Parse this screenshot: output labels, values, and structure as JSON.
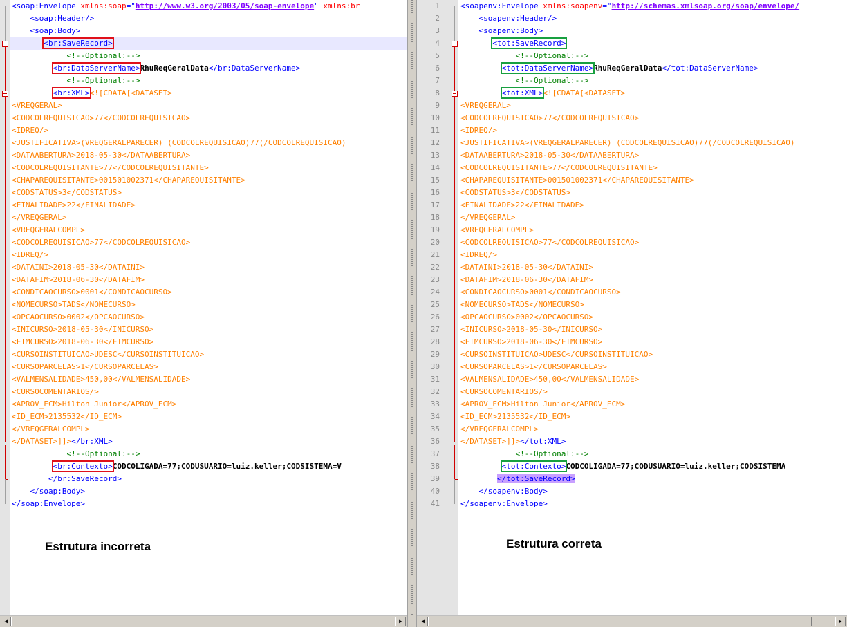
{
  "left": {
    "caption": "Estrutura incorreta",
    "lines": [
      [
        [
          "t",
          "<soap:Envelope "
        ],
        [
          "a",
          "xmlns:soap"
        ],
        [
          "t",
          "=\""
        ],
        [
          "v",
          "http://www.w3.org/2003/05/soap-envelope"
        ],
        [
          "t",
          "\" "
        ],
        [
          "a",
          "xmlns:br"
        ]
      ],
      [
        [
          "t",
          "    <soap:Header/>"
        ]
      ],
      [
        [
          "t",
          "    <soap:Body>"
        ]
      ],
      [
        [
          "s",
          "       "
        ],
        [
          "tbr",
          "<br:SaveRecord>"
        ]
      ],
      [
        [
          "s",
          "            "
        ],
        [
          "c",
          "<!--Optional:-->"
        ]
      ],
      [
        [
          "s",
          "         "
        ],
        [
          "tbr",
          "<br:DataServerName>"
        ],
        [
          "x",
          "RhuReqGeralData"
        ],
        [
          "t",
          "</br:DataServerName>"
        ]
      ],
      [
        [
          "s",
          "            "
        ],
        [
          "c",
          "<!--Optional:-->"
        ]
      ],
      [
        [
          "s",
          "         "
        ],
        [
          "tbr",
          "<br:XML>"
        ],
        [
          "d",
          "<![CDATA[<DATASET>"
        ]
      ],
      [
        [
          "d",
          "<VREQGERAL>"
        ]
      ],
      [
        [
          "d",
          "<CODCOLREQUISICAO>77</CODCOLREQUISICAO>"
        ]
      ],
      [
        [
          "d",
          "<IDREQ/>"
        ]
      ],
      [
        [
          "d",
          "<JUSTIFICATIVA>(VREQGERALPARECER) (CODCOLREQUISICAO)77(/CODCOLREQUISICAO)"
        ]
      ],
      [
        [
          "d",
          "<DATAABERTURA>2018-05-30</DATAABERTURA>"
        ]
      ],
      [
        [
          "d",
          "<CODCOLREQUISITANTE>77</CODCOLREQUISITANTE>"
        ]
      ],
      [
        [
          "d",
          "<CHAPAREQUISITANTE>001501002371</CHAPAREQUISITANTE>"
        ]
      ],
      [
        [
          "d",
          "<CODSTATUS>3</CODSTATUS>"
        ]
      ],
      [
        [
          "d",
          "<FINALIDADE>22</FINALIDADE>"
        ]
      ],
      [
        [
          "d",
          "</VREQGERAL>"
        ]
      ],
      [
        [
          "d",
          "<VREQGERALCOMPL>"
        ]
      ],
      [
        [
          "d",
          "<CODCOLREQUISICAO>77</CODCOLREQUISICAO>"
        ]
      ],
      [
        [
          "d",
          "<IDREQ/>"
        ]
      ],
      [
        [
          "d",
          "<DATAINI>2018-05-30</DATAINI>"
        ]
      ],
      [
        [
          "d",
          "<DATAFIM>2018-06-30</DATAFIM>"
        ]
      ],
      [
        [
          "d",
          "<CONDICAOCURSO>0001</CONDICAOCURSO>"
        ]
      ],
      [
        [
          "d",
          "<NOMECURSO>TADS</NOMECURSO>"
        ]
      ],
      [
        [
          "d",
          "<OPCAOCURSO>0002</OPCAOCURSO>"
        ]
      ],
      [
        [
          "d",
          "<INICURSO>2018-05-30</INICURSO>"
        ]
      ],
      [
        [
          "d",
          "<FIMCURSO>2018-06-30</FIMCURSO>"
        ]
      ],
      [
        [
          "d",
          "<CURSOINSTITUICAO>UDESC</CURSOINSTITUICAO>"
        ]
      ],
      [
        [
          "d",
          "<CURSOPARCELAS>1</CURSOPARCELAS>"
        ]
      ],
      [
        [
          "d",
          "<VALMENSALIDADE>450,00</VALMENSALIDADE>"
        ]
      ],
      [
        [
          "d",
          "<CURSOCOMENTARIOS/>"
        ]
      ],
      [
        [
          "d",
          "<APROV_ECM>Hilton Junior</APROV_ECM>"
        ]
      ],
      [
        [
          "d",
          "<ID_ECM>2135532</ID_ECM>"
        ]
      ],
      [
        [
          "d",
          "</VREQGERALCOMPL>"
        ]
      ],
      [
        [
          "d",
          "</DATASET>]]>"
        ],
        [
          "t",
          "</br:XML>"
        ]
      ],
      [
        [
          "s",
          "            "
        ],
        [
          "c",
          "<!--Optional:-->"
        ]
      ],
      [
        [
          "s",
          "         "
        ],
        [
          "tbr",
          "<br:Contexto>"
        ],
        [
          "x",
          "CODCOLIGADA=77;CODUSUARIO=luiz.keller;CODSISTEMA=V"
        ]
      ],
      [
        [
          "t",
          "        </br:SaveRecord>"
        ]
      ],
      [
        [
          "t",
          "    </soap:Body>"
        ]
      ],
      [
        [
          "t",
          "</soap:Envelope>"
        ]
      ]
    ]
  },
  "right": {
    "caption": "Estrutura correta",
    "line_numbers": [
      "1",
      "2",
      "3",
      "4",
      "5",
      "6",
      "7",
      "8",
      "9",
      "10",
      "11",
      "12",
      "13",
      "14",
      "15",
      "16",
      "17",
      "18",
      "19",
      "20",
      "21",
      "22",
      "23",
      "24",
      "25",
      "26",
      "27",
      "28",
      "29",
      "30",
      "31",
      "32",
      "33",
      "34",
      "35",
      "36",
      "37",
      "38",
      "39",
      "40",
      "41"
    ],
    "lines": [
      [
        [
          "t",
          "<soapenv:Envelope "
        ],
        [
          "a",
          "xmlns:soapenv"
        ],
        [
          "t",
          "=\""
        ],
        [
          "v",
          "http://schemas.xmlsoap.org/soap/envelope/"
        ]
      ],
      [
        [
          "t",
          "    <soapenv:Header/>"
        ]
      ],
      [
        [
          "t",
          "    <soapenv:Body>"
        ]
      ],
      [
        [
          "s",
          "       "
        ],
        [
          "tbg",
          "<tot:SaveRecord>"
        ]
      ],
      [
        [
          "s",
          "            "
        ],
        [
          "c",
          "<!--Optional:-->"
        ]
      ],
      [
        [
          "s",
          "         "
        ],
        [
          "tbg",
          "<tot:DataServerName>"
        ],
        [
          "x",
          "RhuReqGeralData"
        ],
        [
          "t",
          "</tot:DataServerName>"
        ]
      ],
      [
        [
          "s",
          "            "
        ],
        [
          "c",
          "<!--Optional:-->"
        ]
      ],
      [
        [
          "s",
          "         "
        ],
        [
          "tbg",
          "<tot:XML>"
        ],
        [
          "d",
          "<![CDATA[<DATASET>"
        ]
      ],
      [
        [
          "d",
          "<VREQGERAL>"
        ]
      ],
      [
        [
          "d",
          "<CODCOLREQUISICAO>77</CODCOLREQUISICAO>"
        ]
      ],
      [
        [
          "d",
          "<IDREQ/>"
        ]
      ],
      [
        [
          "d",
          "<JUSTIFICATIVA>(VREQGERALPARECER) (CODCOLREQUISICAO)77(/CODCOLREQUISICAO)"
        ]
      ],
      [
        [
          "d",
          "<DATAABERTURA>2018-05-30</DATAABERTURA>"
        ]
      ],
      [
        [
          "d",
          "<CODCOLREQUISITANTE>77</CODCOLREQUISITANTE>"
        ]
      ],
      [
        [
          "d",
          "<CHAPAREQUISITANTE>001501002371</CHAPAREQUISITANTE>"
        ]
      ],
      [
        [
          "d",
          "<CODSTATUS>3</CODSTATUS>"
        ]
      ],
      [
        [
          "d",
          "<FINALIDADE>22</FINALIDADE>"
        ]
      ],
      [
        [
          "d",
          "</VREQGERAL>"
        ]
      ],
      [
        [
          "d",
          "<VREQGERALCOMPL>"
        ]
      ],
      [
        [
          "d",
          "<CODCOLREQUISICAO>77</CODCOLREQUISICAO>"
        ]
      ],
      [
        [
          "d",
          "<IDREQ/>"
        ]
      ],
      [
        [
          "d",
          "<DATAINI>2018-05-30</DATAINI>"
        ]
      ],
      [
        [
          "d",
          "<DATAFIM>2018-06-30</DATAFIM>"
        ]
      ],
      [
        [
          "d",
          "<CONDICAOCURSO>0001</CONDICAOCURSO>"
        ]
      ],
      [
        [
          "d",
          "<NOMECURSO>TADS</NOMECURSO>"
        ]
      ],
      [
        [
          "d",
          "<OPCAOCURSO>0002</OPCAOCURSO>"
        ]
      ],
      [
        [
          "d",
          "<INICURSO>2018-05-30</INICURSO>"
        ]
      ],
      [
        [
          "d",
          "<FIMCURSO>2018-06-30</FIMCURSO>"
        ]
      ],
      [
        [
          "d",
          "<CURSOINSTITUICAO>UDESC</CURSOINSTITUICAO>"
        ]
      ],
      [
        [
          "d",
          "<CURSOPARCELAS>1</CURSOPARCELAS>"
        ]
      ],
      [
        [
          "d",
          "<VALMENSALIDADE>450,00</VALMENSALIDADE>"
        ]
      ],
      [
        [
          "d",
          "<CURSOCOMENTARIOS/>"
        ]
      ],
      [
        [
          "d",
          "<APROV_ECM>Hilton Junior</APROV_ECM>"
        ]
      ],
      [
        [
          "d",
          "<ID_ECM>2135532</ID_ECM>"
        ]
      ],
      [
        [
          "d",
          "</VREQGERALCOMPL>"
        ]
      ],
      [
        [
          "d",
          "</DATASET>]]>"
        ],
        [
          "t",
          "</tot:XML>"
        ]
      ],
      [
        [
          "s",
          "            "
        ],
        [
          "c",
          "<!--Optional:-->"
        ]
      ],
      [
        [
          "s",
          "         "
        ],
        [
          "tbg",
          "<tot:Contexto>"
        ],
        [
          "x",
          "CODCOLIGADA=77;CODUSUARIO=luiz.keller;CODSISTEMA"
        ]
      ],
      [
        [
          "s",
          "        "
        ],
        [
          "te",
          "</tot:SaveRecord>"
        ]
      ],
      [
        [
          "t",
          "    </soapenv:Body>"
        ]
      ],
      [
        [
          "t",
          "</soapenv:Envelope>"
        ]
      ]
    ]
  },
  "colors": {
    "tag": "#0000ff",
    "attribute": "#ff0000",
    "attribute_value": "#8000ff",
    "comment": "#008000",
    "cdata": "#ff8000",
    "text": "#000000",
    "incorrect_box": "#e0101a",
    "correct_box": "#18a040",
    "matching_tag_highlight": "#c8a0ff"
  },
  "icons": [
    "fold-minus-icon",
    "scroll-left-arrow-icon",
    "scroll-right-arrow-icon"
  ]
}
